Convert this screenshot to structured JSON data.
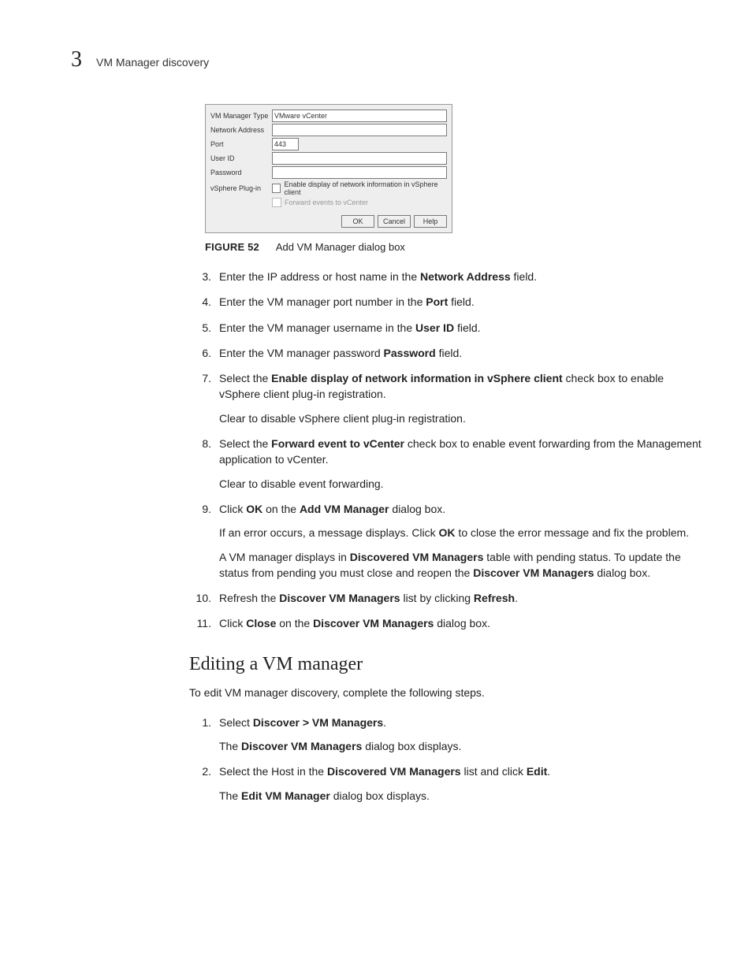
{
  "header": {
    "chapter": "3",
    "title": "VM Manager discovery"
  },
  "dialog": {
    "rows": {
      "type_label": "VM Manager Type",
      "type_value": "VMware vCenter",
      "addr_label": "Network Address",
      "addr_value": "",
      "port_label": "Port",
      "port_value": "443",
      "user_label": "User ID",
      "user_value": "",
      "pwd_label": "Password",
      "pwd_value": "",
      "plugin_label": "vSphere Plug-in",
      "plugin_chk": "Enable display of network information in vSphere client",
      "forward_chk": "Forward events to vCenter"
    },
    "buttons": {
      "ok": "OK",
      "cancel": "Cancel",
      "help": "Help"
    }
  },
  "figure": {
    "num": "FIGURE 52",
    "caption": "Add VM Manager dialog box"
  },
  "steps": [
    {
      "num": "3.",
      "parts": [
        {
          "t": "Enter the IP address or host name in the "
        },
        {
          "t": "Network Address",
          "b": true
        },
        {
          "t": " field."
        }
      ]
    },
    {
      "num": "4.",
      "parts": [
        {
          "t": "Enter the VM manager port number in the "
        },
        {
          "t": "Port",
          "b": true
        },
        {
          "t": " field."
        }
      ]
    },
    {
      "num": "5.",
      "parts": [
        {
          "t": "Enter the VM manager username in the "
        },
        {
          "t": "User ID",
          "b": true
        },
        {
          "t": " field."
        }
      ]
    },
    {
      "num": "6.",
      "parts": [
        {
          "t": "Enter the VM manager password "
        },
        {
          "t": "Password",
          "b": true
        },
        {
          "t": " field."
        }
      ]
    },
    {
      "num": "7.",
      "paras": [
        [
          {
            "t": "Select the "
          },
          {
            "t": "Enable display of network information in vSphere client",
            "b": true
          },
          {
            "t": " check box to enable vSphere client plug-in registration."
          }
        ],
        [
          {
            "t": "Clear to disable vSphere client plug-in registration."
          }
        ]
      ]
    },
    {
      "num": "8.",
      "paras": [
        [
          {
            "t": "Select the "
          },
          {
            "t": "Forward event to vCenter",
            "b": true
          },
          {
            "t": " check box to enable event forwarding from the Management application to vCenter."
          }
        ],
        [
          {
            "t": "Clear to disable event forwarding."
          }
        ]
      ]
    },
    {
      "num": "9.",
      "paras": [
        [
          {
            "t": "Click "
          },
          {
            "t": "OK",
            "b": true
          },
          {
            "t": " on the "
          },
          {
            "t": "Add VM Manager",
            "b": true
          },
          {
            "t": " dialog box."
          }
        ],
        [
          {
            "t": "If an error occurs, a message displays. Click "
          },
          {
            "t": "OK",
            "b": true
          },
          {
            "t": " to close the error message and fix the problem."
          }
        ],
        [
          {
            "t": "A VM manager displays in "
          },
          {
            "t": "Discovered VM Managers",
            "b": true
          },
          {
            "t": " table with pending status. To update the status from pending you must close and reopen the "
          },
          {
            "t": "Discover VM Managers",
            "b": true
          },
          {
            "t": " dialog box."
          }
        ]
      ]
    },
    {
      "num": "10.",
      "parts": [
        {
          "t": "Refresh the "
        },
        {
          "t": "Discover VM Managers",
          "b": true
        },
        {
          "t": " list by clicking "
        },
        {
          "t": "Refresh",
          "b": true
        },
        {
          "t": "."
        }
      ]
    },
    {
      "num": "11.",
      "parts": [
        {
          "t": "Click "
        },
        {
          "t": "Close",
          "b": true
        },
        {
          "t": " on the "
        },
        {
          "t": "Discover VM Managers",
          "b": true
        },
        {
          "t": " dialog box."
        }
      ]
    }
  ],
  "subsection": {
    "heading": "Editing a VM manager",
    "intro": "To edit VM manager discovery, complete the following steps.",
    "steps": [
      {
        "num": "1.",
        "paras": [
          [
            {
              "t": "Select "
            },
            {
              "t": "Discover > VM Managers",
              "b": true
            },
            {
              "t": "."
            }
          ],
          [
            {
              "t": "The "
            },
            {
              "t": "Discover VM Managers",
              "b": true
            },
            {
              "t": " dialog box displays."
            }
          ]
        ]
      },
      {
        "num": "2.",
        "paras": [
          [
            {
              "t": "Select the Host in the "
            },
            {
              "t": "Discovered VM Managers",
              "b": true
            },
            {
              "t": " list and click "
            },
            {
              "t": "Edit",
              "b": true
            },
            {
              "t": "."
            }
          ],
          [
            {
              "t": "The "
            },
            {
              "t": "Edit VM Manager",
              "b": true
            },
            {
              "t": " dialog box displays."
            }
          ]
        ]
      }
    ]
  }
}
